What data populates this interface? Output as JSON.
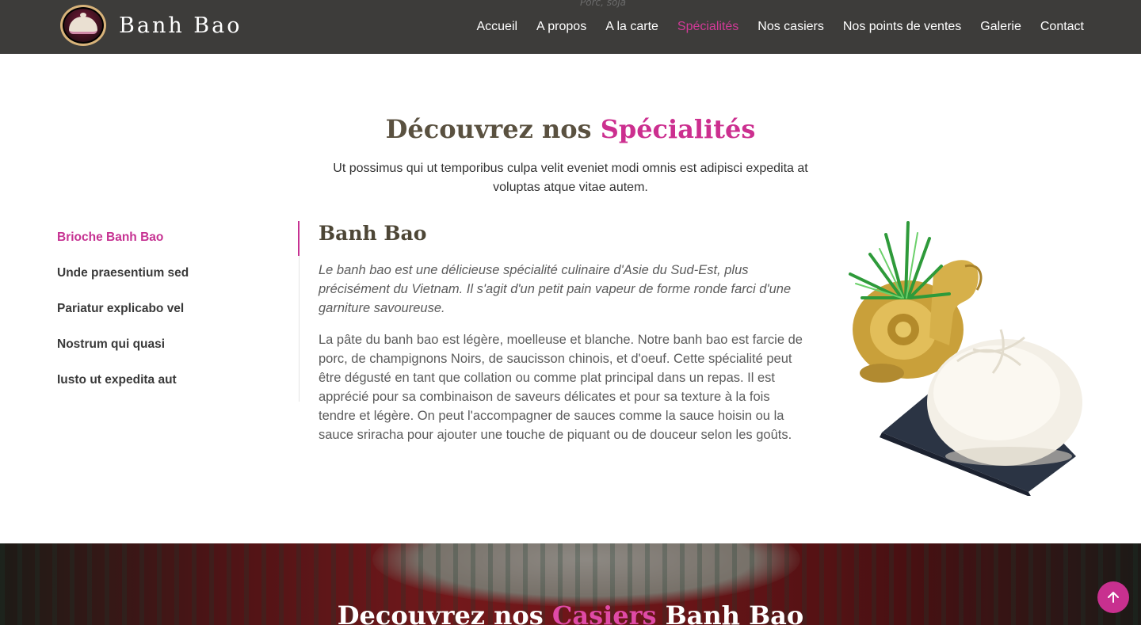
{
  "header": {
    "peek_text": "Porc, soja",
    "brand": "Banh Bao",
    "nav": [
      {
        "label": "Accueil",
        "active": false
      },
      {
        "label": "A propos",
        "active": false
      },
      {
        "label": "A la carte",
        "active": false
      },
      {
        "label": "Spécialités",
        "active": true
      },
      {
        "label": "Nos casiers",
        "active": false
      },
      {
        "label": "Nos points de ventes",
        "active": false
      },
      {
        "label": "Galerie",
        "active": false
      },
      {
        "label": "Contact",
        "active": false
      }
    ]
  },
  "section": {
    "title_part1": "Découvrez nos",
    "title_accent": "Spécialités",
    "subtitle": "Ut possimus qui ut temporibus culpa velit eveniet modi omnis est adipisci expedita at voluptas atque vitae autem."
  },
  "tabs": [
    {
      "label": "Brioche Banh Bao",
      "active": true
    },
    {
      "label": "Unde praesentium sed",
      "active": false
    },
    {
      "label": "Pariatur explicabo vel",
      "active": false
    },
    {
      "label": "Nostrum qui quasi",
      "active": false
    },
    {
      "label": "Iusto ut expedita aut",
      "active": false
    }
  ],
  "content": {
    "heading": "Banh Bao",
    "lead": "Le banh bao est une délicieuse spécialité culinaire d'Asie du Sud-Est, plus précisément du Vietnam. Il s'agit d'un petit pain vapeur de forme ronde farci d'une garniture savoureuse.",
    "body": "La pâte du banh bao est légère, moelleuse et blanche. Notre banh bao est farcie de porc, de champignons Noirs, de saucisson chinois, et d'oeuf. Cette spécialité peut être dégusté en tant que collation ou comme plat principal dans un repas. Il est apprécié pour sa combinaison de saveurs délicates et pour sa texture à la fois tendre et légère. On peut l'accompagner de sauces comme la sauce hoisin ou la sauce sriracha pour ajouter une touche de piquant ou de douceur selon les goûts."
  },
  "banner": {
    "title_part1": "Decouvrez nos",
    "title_accent": "Casiers",
    "title_part2": "Banh Bao"
  },
  "colors": {
    "accent": "#c8308f",
    "header_bg": "#3d3c3a",
    "heading": "#5a5140"
  },
  "icons": {
    "scroll_top": "arrow-up-icon",
    "logo": "banh-bao-logo"
  }
}
